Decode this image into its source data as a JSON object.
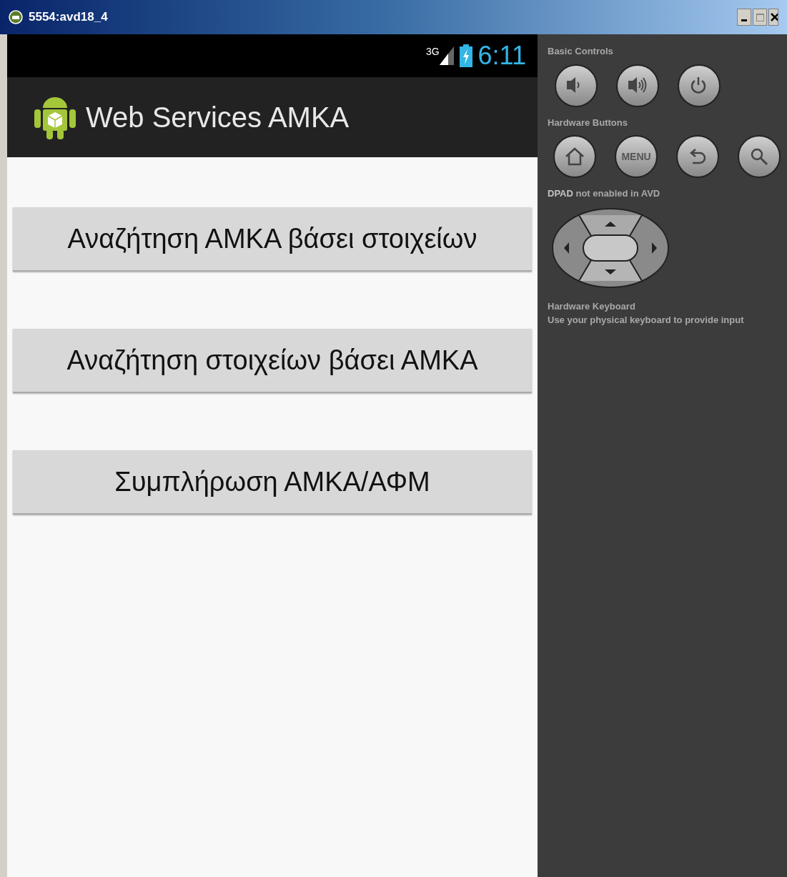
{
  "window": {
    "title": "5554:avd18_4"
  },
  "status_bar": {
    "network": "3G",
    "time": "6:11"
  },
  "action_bar": {
    "title": "Web Services AMKA"
  },
  "buttons": [
    "Αναζήτηση ΑΜΚΑ βάσει στοιχείων",
    "Αναζήτηση στοιχείων βάσει ΑΜΚΑ",
    "Συμπλήρωση ΑΜΚΑ/ΑΦΜ"
  ],
  "controls_panel": {
    "basic_controls": {
      "label": "Basic Controls",
      "buttons": [
        {
          "kind": "volume_down"
        },
        {
          "kind": "volume_up"
        },
        {
          "kind": "power"
        }
      ]
    },
    "hardware_buttons": {
      "label": "Hardware Buttons",
      "buttons": [
        {
          "kind": "home"
        },
        {
          "kind": "menu",
          "label": "MENU"
        },
        {
          "kind": "back"
        },
        {
          "kind": "search"
        }
      ]
    },
    "dpad": {
      "note": "**DPAD** not enabled in AVD"
    },
    "keyboard": {
      "title": "Hardware Keyboard",
      "text": "Use your physical keyboard to provide input"
    }
  }
}
